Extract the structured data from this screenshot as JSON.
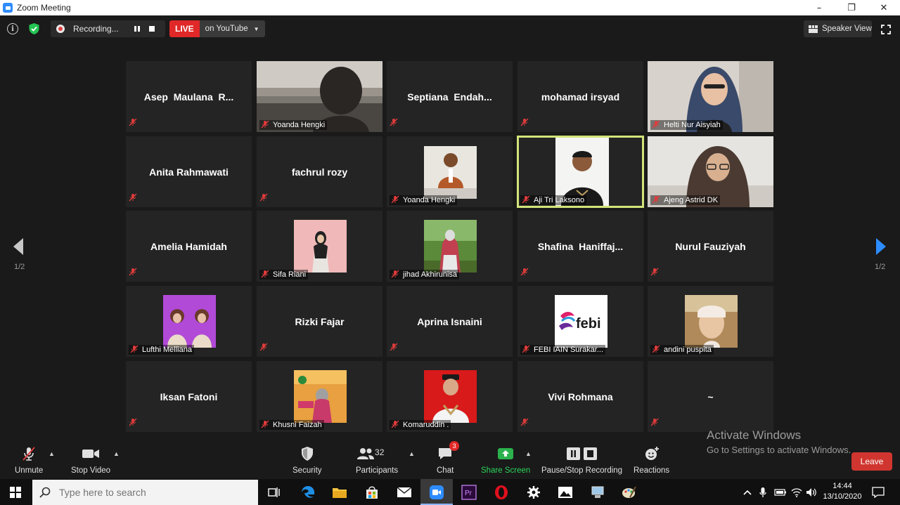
{
  "window": {
    "title": "Zoom Meeting",
    "min_glyph": "–",
    "max_glyph": "❐",
    "close_glyph": "✕"
  },
  "topbar": {
    "recording_label": "Recording...",
    "live_label": "LIVE",
    "live_destination": "on YouTube",
    "view_label": "Speaker View"
  },
  "tiles": [
    {
      "name": "Asep  Maulana  R...",
      "video": false
    },
    {
      "name": "Yoanda Hengki",
      "video": true,
      "thumb": "dark-room"
    },
    {
      "name": "Septiana  Endah...",
      "video": false
    },
    {
      "name": "mohamad irsyad",
      "video": false
    },
    {
      "name": "Helti Nur Aisyiah",
      "video": true,
      "thumb": "hijab-headset"
    },
    {
      "name": "Anita Rahmawati",
      "video": false
    },
    {
      "name": "fachrul rozy",
      "video": false
    },
    {
      "name": "Yoanda Hengki",
      "video": true,
      "thumb": "photo-man"
    },
    {
      "name": "Aji Tri Laksono",
      "video": true,
      "thumb": "man-dark",
      "active": true
    },
    {
      "name": "Ajeng Astrid DK",
      "video": true,
      "thumb": "hijab-glasses"
    },
    {
      "name": "Amelia Hamidah",
      "video": false
    },
    {
      "name": "Sifa Riani",
      "video": true,
      "thumb": "photo-pink"
    },
    {
      "name": "jihad Akhirunisa",
      "video": true,
      "thumb": "photo-green"
    },
    {
      "name": "Shafina  Haniffaj...",
      "video": false
    },
    {
      "name": "Nurul Fauziyah",
      "video": false
    },
    {
      "name": "Lufthi Melliana",
      "video": true,
      "thumb": "photo-purple"
    },
    {
      "name": "Rizki Fajar",
      "video": false
    },
    {
      "name": "Aprina Isnaini",
      "video": false
    },
    {
      "name": "FEBI IAIN Surakar...",
      "video": true,
      "thumb": "febi-logo",
      "logo_text": "febi"
    },
    {
      "name": "andini puspita",
      "video": true,
      "thumb": "photo-face"
    },
    {
      "name": "Iksan Fatoni",
      "video": false
    },
    {
      "name": "Khusni Faizah",
      "video": true,
      "thumb": "photo-poster"
    },
    {
      "name": "Komaruddin .",
      "video": true,
      "thumb": "photo-red"
    },
    {
      "name": "Vivi Rohmana",
      "video": false
    },
    {
      "name": "~",
      "video": false
    }
  ],
  "nav": {
    "left_page": "1/2",
    "right_page": "1/2"
  },
  "toolbar": {
    "unmute": "Unmute",
    "stop_video": "Stop Video",
    "security": "Security",
    "participants": "Participants",
    "participants_count": "32",
    "chat": "Chat",
    "chat_badge": "3",
    "share_screen": "Share Screen",
    "pause_stop_recording": "Pause/Stop Recording",
    "reactions": "Reactions",
    "leave": "Leave"
  },
  "watermark": {
    "line1": "Activate Windows",
    "line2": "Go to Settings to activate Windows."
  },
  "taskbar": {
    "search_placeholder": "Type here to search",
    "time": "14:44",
    "date": "13/10/2020"
  },
  "colors": {
    "active_speaker": "#d2e37a",
    "live": "#e02828",
    "share_green": "#2bb24c",
    "leave": "#d0362f",
    "nav_blue": "#2d8cff"
  }
}
